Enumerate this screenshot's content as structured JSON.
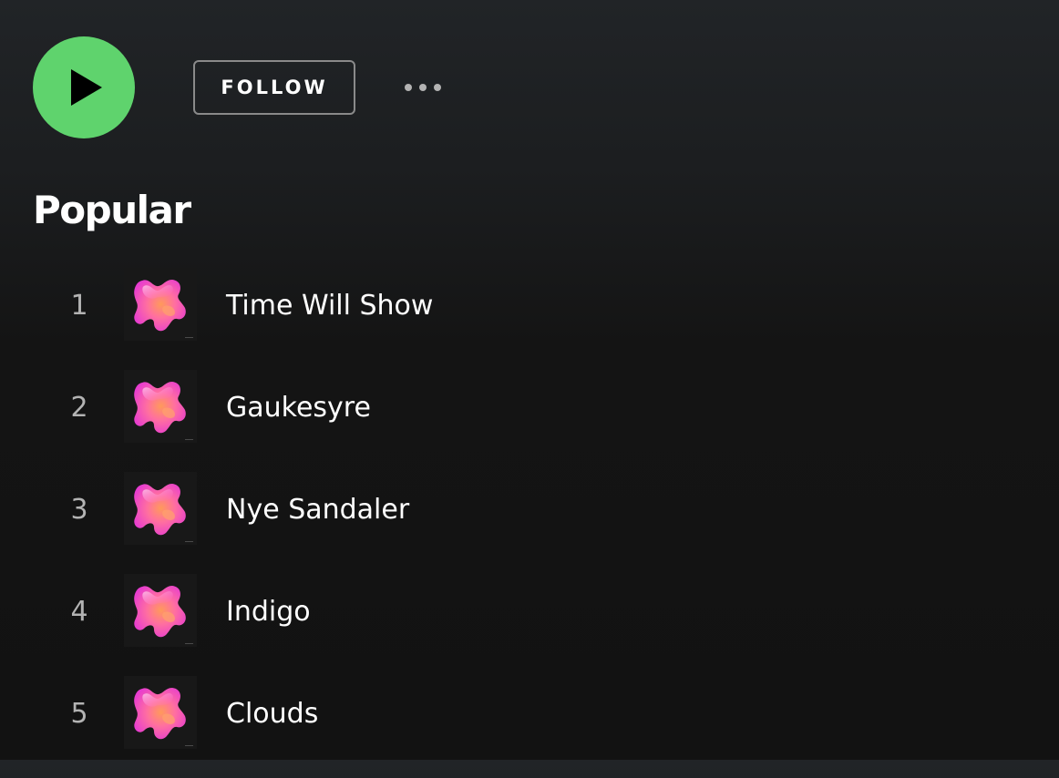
{
  "actions": {
    "play_icon": "play-icon",
    "follow_label": "FOLLOW",
    "more_icon": "more-options-icon"
  },
  "popular": {
    "title": "Popular",
    "tracks": [
      {
        "number": "1",
        "title": "Time Will Show"
      },
      {
        "number": "2",
        "title": "Gaukesyre"
      },
      {
        "number": "3",
        "title": "Nye Sandaler"
      },
      {
        "number": "4",
        "title": "Indigo"
      },
      {
        "number": "5",
        "title": "Clouds"
      }
    ]
  },
  "colors": {
    "accent": "#5fd36d",
    "background": "#121212",
    "text_primary": "#ffffff",
    "text_secondary": "#b3b3b3"
  }
}
